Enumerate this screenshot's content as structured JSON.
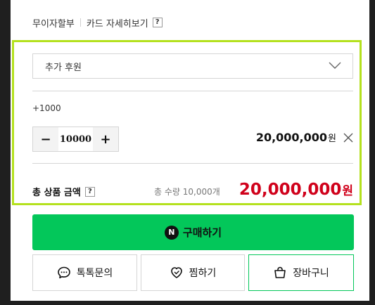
{
  "installment": {
    "label": "무이자할부",
    "card_details": "카드 자세히보기",
    "help": "?"
  },
  "option_select": {
    "selected": "추가 후원",
    "icon": "chevron-down-icon"
  },
  "item": {
    "option_label": "+1000",
    "minus": "−",
    "plus": "+",
    "quantity": "10000",
    "price": "20,000,000",
    "unit": "원",
    "remove_icon": "close-icon"
  },
  "total": {
    "label": "총 상품 금액",
    "help": "?",
    "quantity_text": "총 수량 10,000개",
    "price": "20,000,000",
    "unit": "원"
  },
  "actions": {
    "buy_icon_letter": "N",
    "buy_label": "구매하기",
    "talk_label": "톡톡문의",
    "wish_label": "찜하기",
    "cart_label": "장바구니"
  },
  "colors": {
    "highlight": "#b4e11e",
    "buy_button": "#03c75a",
    "total_price": "#d0011b",
    "frame": "#1f1f1f"
  }
}
